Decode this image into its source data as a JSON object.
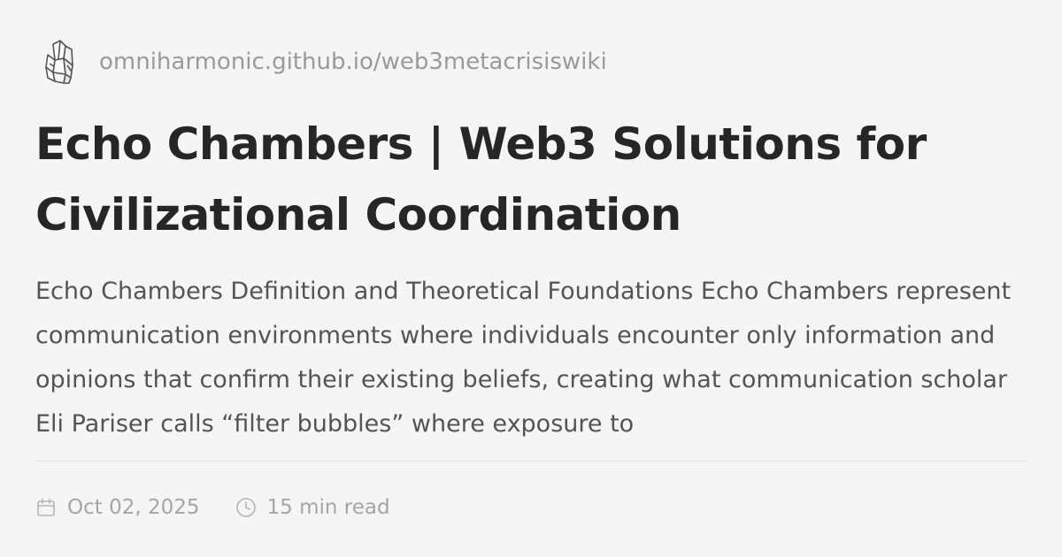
{
  "site": {
    "logo_icon": "crystal-cluster-icon",
    "url": "omniharmonic.github.io/web3metacrisiswiki"
  },
  "article": {
    "title": "Echo Chambers | Web3 Solutions for Civilizational Coordination",
    "excerpt": "Echo Chambers Definition and Theoretical Foundations Echo Chambers represent communication environments where individuals encounter only information and opinions that confirm their existing beliefs, creating what communication scholar Eli Pariser calls “filter bubbles” where exposure to"
  },
  "meta": {
    "date": "Oct 02, 2025",
    "date_icon": "calendar-icon",
    "read_time": "15 min read",
    "read_time_icon": "clock-icon"
  },
  "colors": {
    "background": "#f6f5f5",
    "title": "#262626",
    "excerpt": "#545454",
    "muted": "#9a9a9a"
  }
}
